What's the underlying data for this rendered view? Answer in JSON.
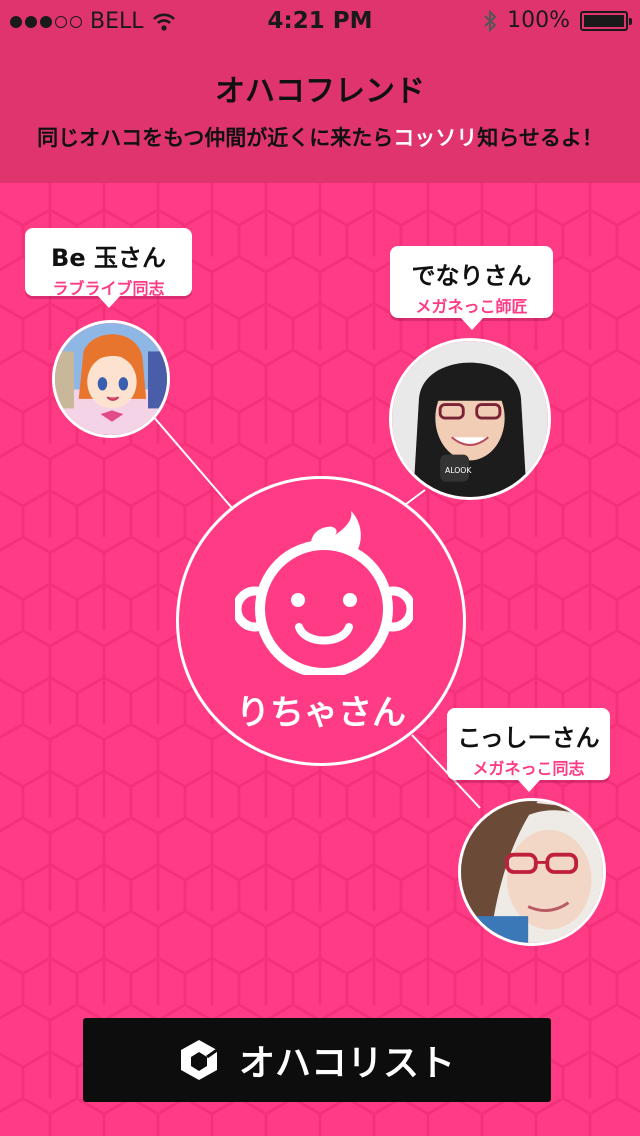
{
  "status_bar": {
    "carrier": "BELL",
    "time": "4:21 PM",
    "battery": "100%",
    "signal_bars_filled": 3,
    "signal_bars_total": 5
  },
  "header": {
    "title": "オハコフレンド",
    "subtitle_before": "同じオハコをもつ仲間が近くに来たら",
    "subtitle_highlight": "コッソリ",
    "subtitle_after": "知らせるよ！"
  },
  "me": {
    "name": "りちゃさん"
  },
  "friends": [
    {
      "name": "Be 玉さん",
      "tag": "ラブライブ同志"
    },
    {
      "name": "でなりさん",
      "tag": "メガネっこ師匠"
    },
    {
      "name": "こっしーさん",
      "tag": "メガネっこ同志"
    }
  ],
  "list_button": {
    "label": "オハコリスト"
  },
  "colors": {
    "accent": "#ff3b86",
    "header": "#e0346f",
    "button": "#0d0d0d"
  }
}
